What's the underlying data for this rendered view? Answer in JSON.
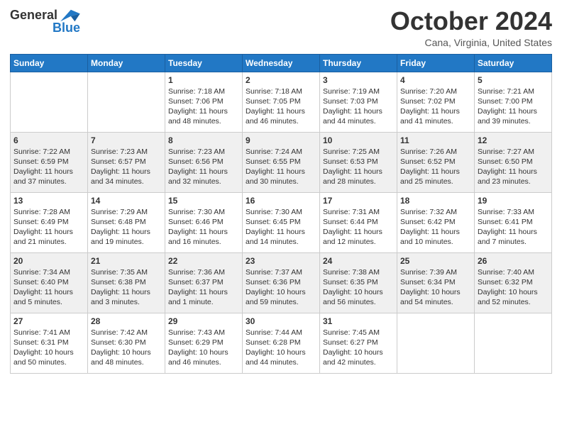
{
  "header": {
    "logo_general": "General",
    "logo_blue": "Blue",
    "month_title": "October 2024",
    "location": "Cana, Virginia, United States"
  },
  "days_of_week": [
    "Sunday",
    "Monday",
    "Tuesday",
    "Wednesday",
    "Thursday",
    "Friday",
    "Saturday"
  ],
  "weeks": [
    [
      {
        "day": null,
        "content": null
      },
      {
        "day": null,
        "content": null
      },
      {
        "day": "1",
        "sunrise": "Sunrise: 7:18 AM",
        "sunset": "Sunset: 7:06 PM",
        "daylight": "Daylight: 11 hours and 48 minutes."
      },
      {
        "day": "2",
        "sunrise": "Sunrise: 7:18 AM",
        "sunset": "Sunset: 7:05 PM",
        "daylight": "Daylight: 11 hours and 46 minutes."
      },
      {
        "day": "3",
        "sunrise": "Sunrise: 7:19 AM",
        "sunset": "Sunset: 7:03 PM",
        "daylight": "Daylight: 11 hours and 44 minutes."
      },
      {
        "day": "4",
        "sunrise": "Sunrise: 7:20 AM",
        "sunset": "Sunset: 7:02 PM",
        "daylight": "Daylight: 11 hours and 41 minutes."
      },
      {
        "day": "5",
        "sunrise": "Sunrise: 7:21 AM",
        "sunset": "Sunset: 7:00 PM",
        "daylight": "Daylight: 11 hours and 39 minutes."
      }
    ],
    [
      {
        "day": "6",
        "sunrise": "Sunrise: 7:22 AM",
        "sunset": "Sunset: 6:59 PM",
        "daylight": "Daylight: 11 hours and 37 minutes."
      },
      {
        "day": "7",
        "sunrise": "Sunrise: 7:23 AM",
        "sunset": "Sunset: 6:57 PM",
        "daylight": "Daylight: 11 hours and 34 minutes."
      },
      {
        "day": "8",
        "sunrise": "Sunrise: 7:23 AM",
        "sunset": "Sunset: 6:56 PM",
        "daylight": "Daylight: 11 hours and 32 minutes."
      },
      {
        "day": "9",
        "sunrise": "Sunrise: 7:24 AM",
        "sunset": "Sunset: 6:55 PM",
        "daylight": "Daylight: 11 hours and 30 minutes."
      },
      {
        "day": "10",
        "sunrise": "Sunrise: 7:25 AM",
        "sunset": "Sunset: 6:53 PM",
        "daylight": "Daylight: 11 hours and 28 minutes."
      },
      {
        "day": "11",
        "sunrise": "Sunrise: 7:26 AM",
        "sunset": "Sunset: 6:52 PM",
        "daylight": "Daylight: 11 hours and 25 minutes."
      },
      {
        "day": "12",
        "sunrise": "Sunrise: 7:27 AM",
        "sunset": "Sunset: 6:50 PM",
        "daylight": "Daylight: 11 hours and 23 minutes."
      }
    ],
    [
      {
        "day": "13",
        "sunrise": "Sunrise: 7:28 AM",
        "sunset": "Sunset: 6:49 PM",
        "daylight": "Daylight: 11 hours and 21 minutes."
      },
      {
        "day": "14",
        "sunrise": "Sunrise: 7:29 AM",
        "sunset": "Sunset: 6:48 PM",
        "daylight": "Daylight: 11 hours and 19 minutes."
      },
      {
        "day": "15",
        "sunrise": "Sunrise: 7:30 AM",
        "sunset": "Sunset: 6:46 PM",
        "daylight": "Daylight: 11 hours and 16 minutes."
      },
      {
        "day": "16",
        "sunrise": "Sunrise: 7:30 AM",
        "sunset": "Sunset: 6:45 PM",
        "daylight": "Daylight: 11 hours and 14 minutes."
      },
      {
        "day": "17",
        "sunrise": "Sunrise: 7:31 AM",
        "sunset": "Sunset: 6:44 PM",
        "daylight": "Daylight: 11 hours and 12 minutes."
      },
      {
        "day": "18",
        "sunrise": "Sunrise: 7:32 AM",
        "sunset": "Sunset: 6:42 PM",
        "daylight": "Daylight: 11 hours and 10 minutes."
      },
      {
        "day": "19",
        "sunrise": "Sunrise: 7:33 AM",
        "sunset": "Sunset: 6:41 PM",
        "daylight": "Daylight: 11 hours and 7 minutes."
      }
    ],
    [
      {
        "day": "20",
        "sunrise": "Sunrise: 7:34 AM",
        "sunset": "Sunset: 6:40 PM",
        "daylight": "Daylight: 11 hours and 5 minutes."
      },
      {
        "day": "21",
        "sunrise": "Sunrise: 7:35 AM",
        "sunset": "Sunset: 6:38 PM",
        "daylight": "Daylight: 11 hours and 3 minutes."
      },
      {
        "day": "22",
        "sunrise": "Sunrise: 7:36 AM",
        "sunset": "Sunset: 6:37 PM",
        "daylight": "Daylight: 11 hours and 1 minute."
      },
      {
        "day": "23",
        "sunrise": "Sunrise: 7:37 AM",
        "sunset": "Sunset: 6:36 PM",
        "daylight": "Daylight: 10 hours and 59 minutes."
      },
      {
        "day": "24",
        "sunrise": "Sunrise: 7:38 AM",
        "sunset": "Sunset: 6:35 PM",
        "daylight": "Daylight: 10 hours and 56 minutes."
      },
      {
        "day": "25",
        "sunrise": "Sunrise: 7:39 AM",
        "sunset": "Sunset: 6:34 PM",
        "daylight": "Daylight: 10 hours and 54 minutes."
      },
      {
        "day": "26",
        "sunrise": "Sunrise: 7:40 AM",
        "sunset": "Sunset: 6:32 PM",
        "daylight": "Daylight: 10 hours and 52 minutes."
      }
    ],
    [
      {
        "day": "27",
        "sunrise": "Sunrise: 7:41 AM",
        "sunset": "Sunset: 6:31 PM",
        "daylight": "Daylight: 10 hours and 50 minutes."
      },
      {
        "day": "28",
        "sunrise": "Sunrise: 7:42 AM",
        "sunset": "Sunset: 6:30 PM",
        "daylight": "Daylight: 10 hours and 48 minutes."
      },
      {
        "day": "29",
        "sunrise": "Sunrise: 7:43 AM",
        "sunset": "Sunset: 6:29 PM",
        "daylight": "Daylight: 10 hours and 46 minutes."
      },
      {
        "day": "30",
        "sunrise": "Sunrise: 7:44 AM",
        "sunset": "Sunset: 6:28 PM",
        "daylight": "Daylight: 10 hours and 44 minutes."
      },
      {
        "day": "31",
        "sunrise": "Sunrise: 7:45 AM",
        "sunset": "Sunset: 6:27 PM",
        "daylight": "Daylight: 10 hours and 42 minutes."
      },
      {
        "day": null,
        "content": null
      },
      {
        "day": null,
        "content": null
      }
    ]
  ]
}
